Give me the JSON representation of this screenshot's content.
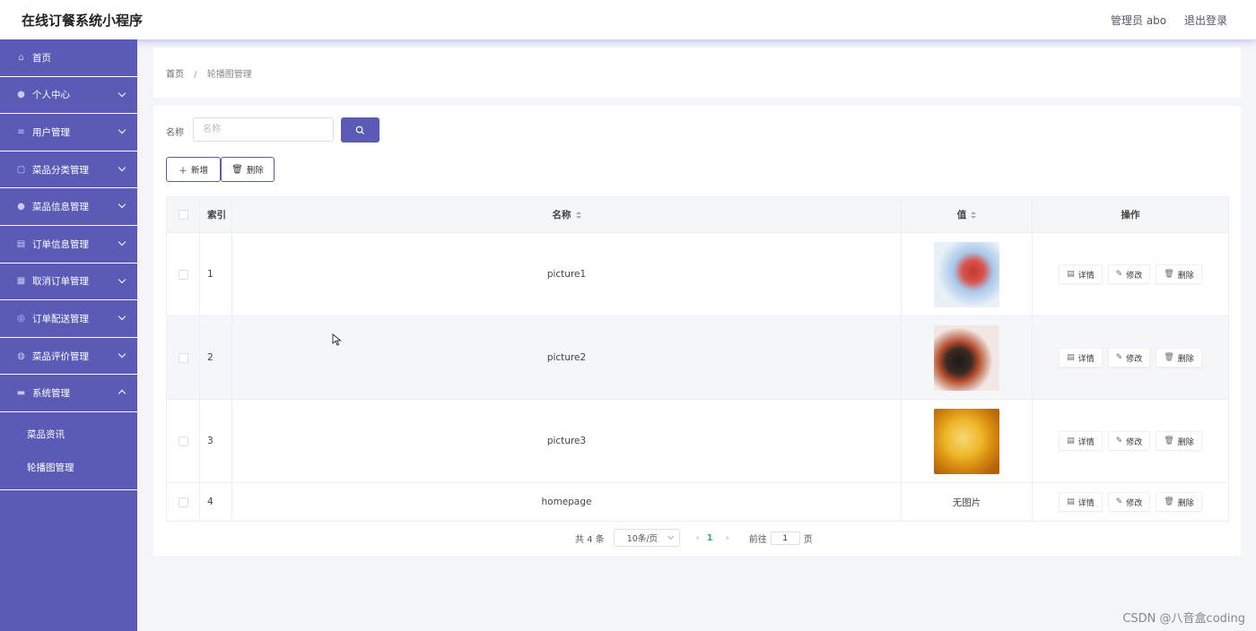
{
  "header": {
    "app_title": "在线订餐系统小程序",
    "user": "管理员 abo",
    "logout": "退出登录"
  },
  "sidebar": {
    "items": [
      {
        "label": "首页",
        "icon": "home-icon"
      },
      {
        "label": "个人中心",
        "icon": "user-icon"
      },
      {
        "label": "用户管理",
        "icon": "list-icon"
      },
      {
        "label": "菜品分类管理",
        "icon": "category-icon"
      },
      {
        "label": "菜品信息管理",
        "icon": "location-icon"
      },
      {
        "label": "订单信息管理",
        "icon": "clipboard-icon"
      },
      {
        "label": "取消订单管理",
        "icon": "grid-icon"
      },
      {
        "label": "订单配送管理",
        "icon": "delivery-icon"
      },
      {
        "label": "菜品评价管理",
        "icon": "comment-icon"
      },
      {
        "label": "系统管理",
        "icon": "settings-icon"
      }
    ],
    "sub_items": [
      {
        "label": "菜品资讯"
      },
      {
        "label": "轮播图管理"
      }
    ]
  },
  "breadcrumb": {
    "home": "首页",
    "separator": "/",
    "current": "轮播图管理"
  },
  "search": {
    "label": "名称",
    "placeholder": "名称"
  },
  "actions": {
    "add": "新增",
    "delete": "删除"
  },
  "table": {
    "headers": {
      "index": "索引",
      "name": "名称",
      "value": "值",
      "ops": "操作"
    },
    "rows": [
      {
        "index": "1",
        "name": "picture1",
        "value": ""
      },
      {
        "index": "2",
        "name": "picture2",
        "value": ""
      },
      {
        "index": "3",
        "name": "picture3",
        "value": ""
      },
      {
        "index": "4",
        "name": "homepage",
        "value": "无图片"
      }
    ],
    "row_actions": {
      "detail": "详情",
      "edit": "修改",
      "delete": "删除"
    }
  },
  "pagination": {
    "total": "共 4 条",
    "page_size": "10条/页",
    "current_page": "1",
    "goto": "前往",
    "goto_value": "1",
    "page_suffix": "页"
  },
  "watermark": "CSDN @八音盒coding",
  "colors": {
    "primary": "#5b5bb7",
    "active_page": "#34b36b"
  }
}
